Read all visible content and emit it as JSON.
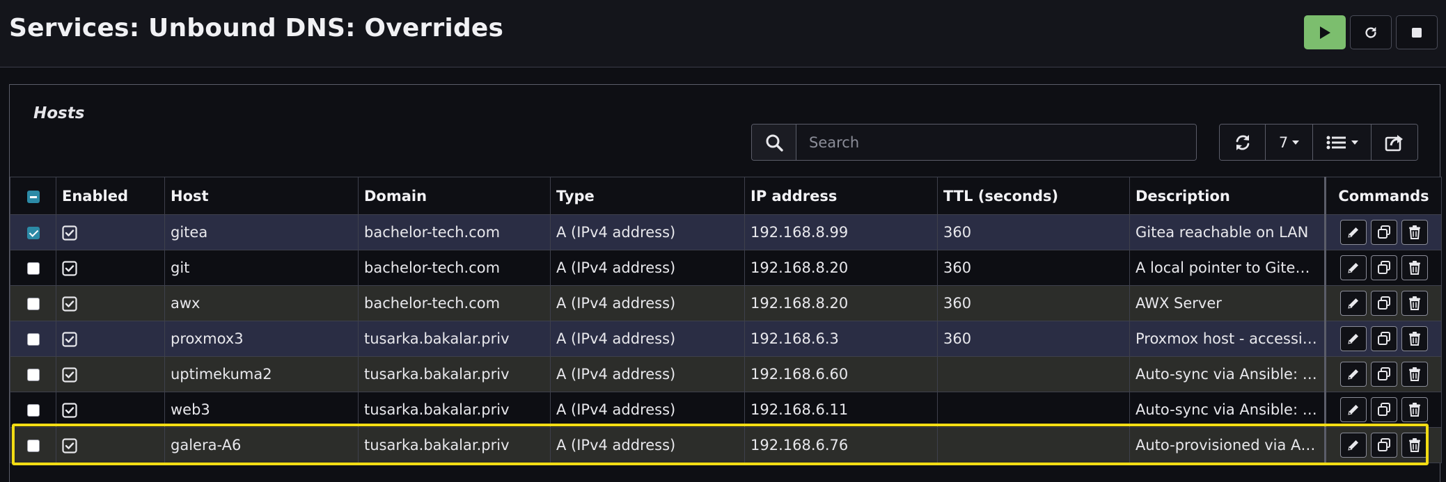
{
  "header": {
    "title": "Services: Unbound DNS: Overrides",
    "actions": [
      {
        "name": "start-service-button",
        "icon": "play-icon"
      },
      {
        "name": "restart-service-button",
        "icon": "refresh-icon"
      },
      {
        "name": "stop-service-button",
        "icon": "stop-icon"
      }
    ],
    "play_color": "#7cbe6e"
  },
  "hosts": {
    "section_title": "Hosts",
    "search": {
      "placeholder": "Search",
      "value": ""
    },
    "toolbar": {
      "page_size": "7"
    },
    "columns": [
      "Enabled",
      "Host",
      "Domain",
      "Type",
      "IP address",
      "TTL (seconds)",
      "Description",
      "Commands"
    ],
    "rows": [
      {
        "selected": true,
        "host": "gitea",
        "domain": "bachelor-tech.com",
        "type": "A (IPv4 address)",
        "ip": "192.168.8.99",
        "ttl": "360",
        "description": "Gitea reachable on LAN"
      },
      {
        "selected": false,
        "host": "git",
        "domain": "bachelor-tech.com",
        "type": "A (IPv4 address)",
        "ip": "192.168.8.20",
        "ttl": "360",
        "description": "A local pointer to Gitea …"
      },
      {
        "selected": false,
        "host": "awx",
        "domain": "bachelor-tech.com",
        "type": "A (IPv4 address)",
        "ip": "192.168.8.20",
        "ttl": "360",
        "description": "AWX Server"
      },
      {
        "selected": false,
        "host": "proxmox3",
        "domain": "tusarka.bakalar.priv",
        "type": "A (IPv4 address)",
        "ip": "192.168.6.3",
        "ttl": "360",
        "description": "Proxmox host - accessi…"
      },
      {
        "selected": false,
        "host": "uptimekuma2",
        "domain": "tusarka.bakalar.priv",
        "type": "A (IPv4 address)",
        "ip": "192.168.6.60",
        "ttl": "",
        "description": "Auto-sync via Ansible: …"
      },
      {
        "selected": false,
        "host": "web3",
        "domain": "tusarka.bakalar.priv",
        "type": "A (IPv4 address)",
        "ip": "192.168.6.11",
        "ttl": "",
        "description": "Auto-sync via Ansible: …"
      },
      {
        "selected": false,
        "host": "galera-A6",
        "domain": "tusarka.bakalar.priv",
        "type": "A (IPv4 address)",
        "ip": "192.168.6.76",
        "ttl": "",
        "description": "Auto-provisioned via A…"
      }
    ],
    "row_styles": [
      "r-blue",
      "r-dark",
      "r-olive",
      "r-blue",
      "r-olive",
      "r-dark",
      "r-olive"
    ],
    "highlight_color": "#f2dc14"
  }
}
